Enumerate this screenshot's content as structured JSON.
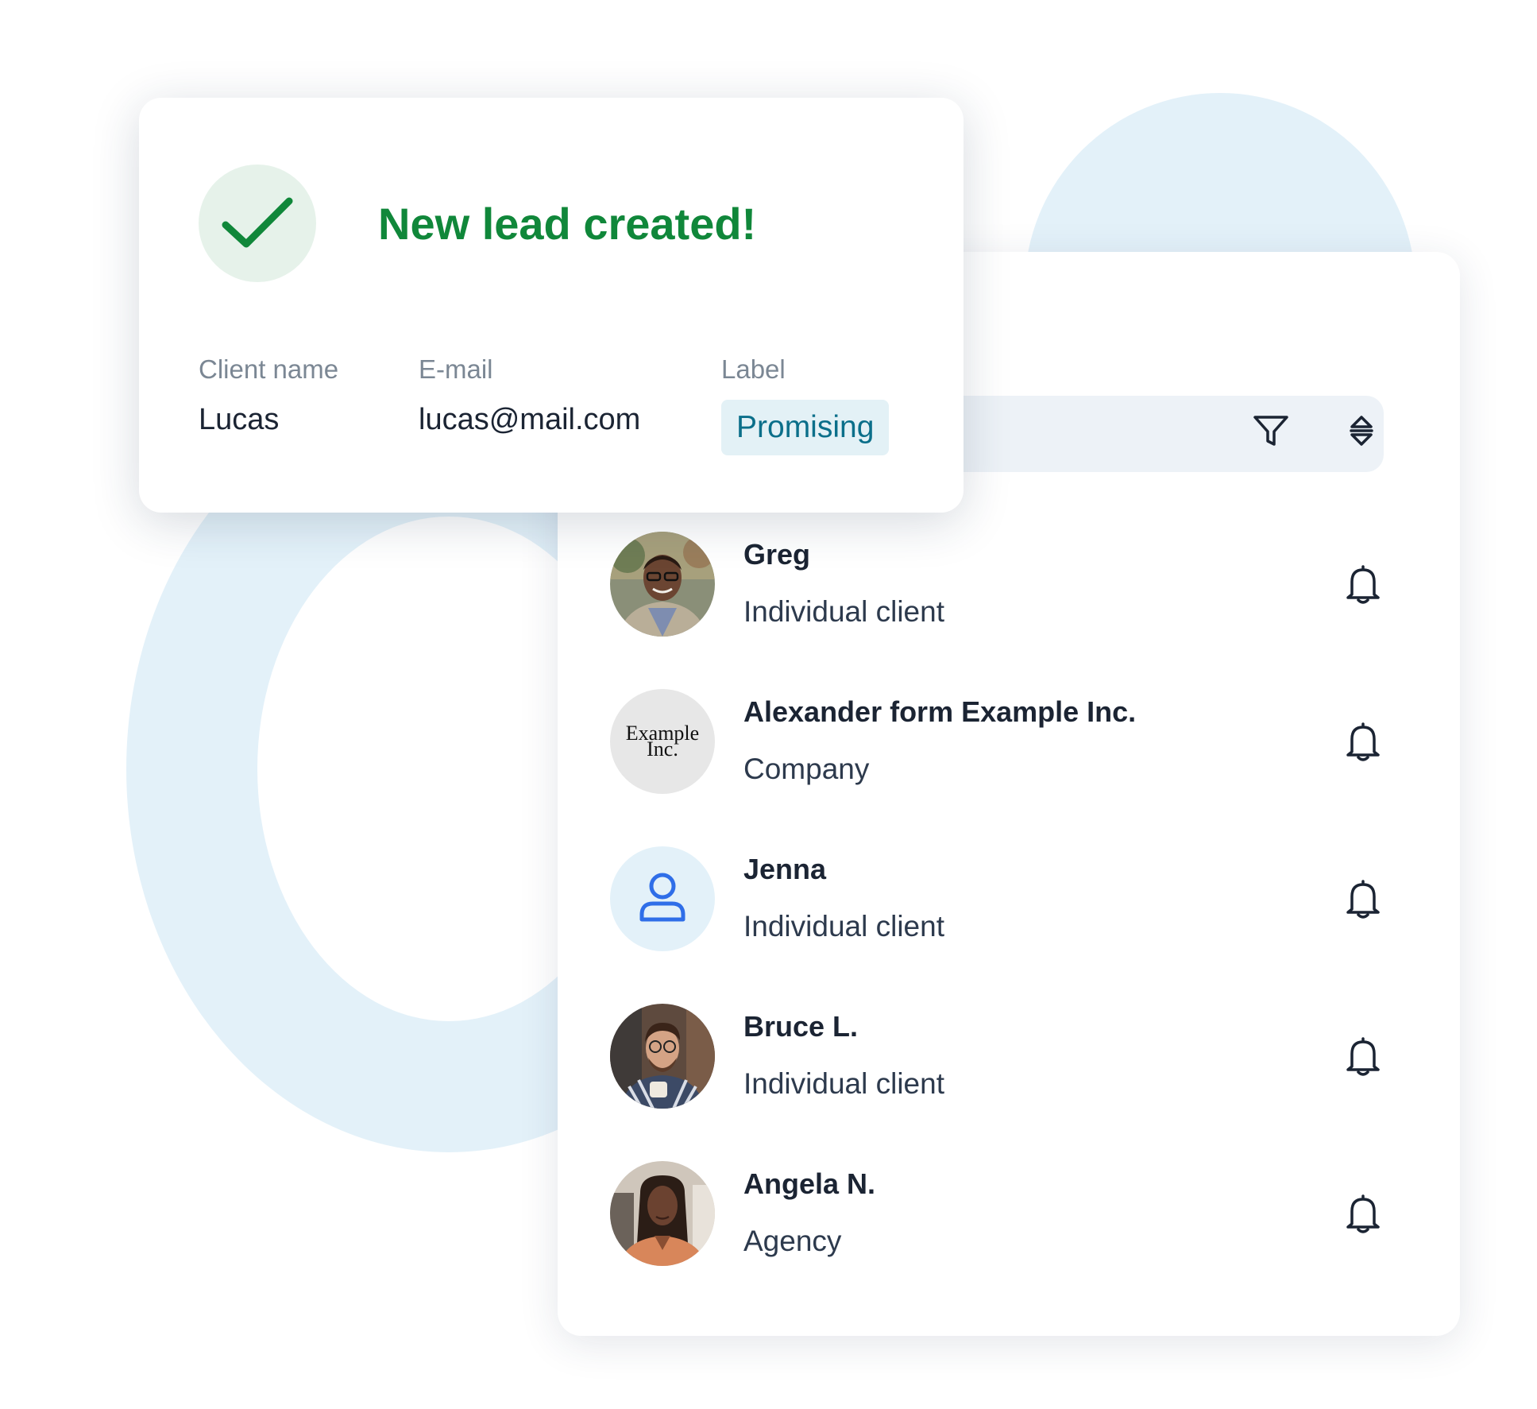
{
  "toast": {
    "title": "New lead created!",
    "icon": "check-icon",
    "accent_color": "#10873a",
    "fields": {
      "client_name_label": "Client name",
      "client_name_value": "Lucas",
      "email_label": "E-mail",
      "email_value": "lucas@mail.com",
      "label_label": "Label",
      "label_value": "Promising"
    }
  },
  "toolbar": {
    "search_placeholder": "",
    "filter_icon": "filter-icon",
    "sort_icon": "sort-icon"
  },
  "contacts": [
    {
      "name": "Greg",
      "type": "Individual client",
      "avatar": "photo"
    },
    {
      "name": "Alexander form Example Inc.",
      "type": "Company",
      "avatar": "logo",
      "logo_text": [
        "Example",
        "Inc."
      ]
    },
    {
      "name": "Jenna",
      "type": "Individual client",
      "avatar": "person-icon"
    },
    {
      "name": "Bruce L.",
      "type": "Individual client",
      "avatar": "photo"
    },
    {
      "name": "Angela N.",
      "type": "Agency",
      "avatar": "photo"
    }
  ],
  "colors": {
    "success_green": "#10873a",
    "chip_background": "#e3f1f6",
    "chip_text": "#0b6f8a",
    "decor_blue": "#e3f1f9"
  }
}
